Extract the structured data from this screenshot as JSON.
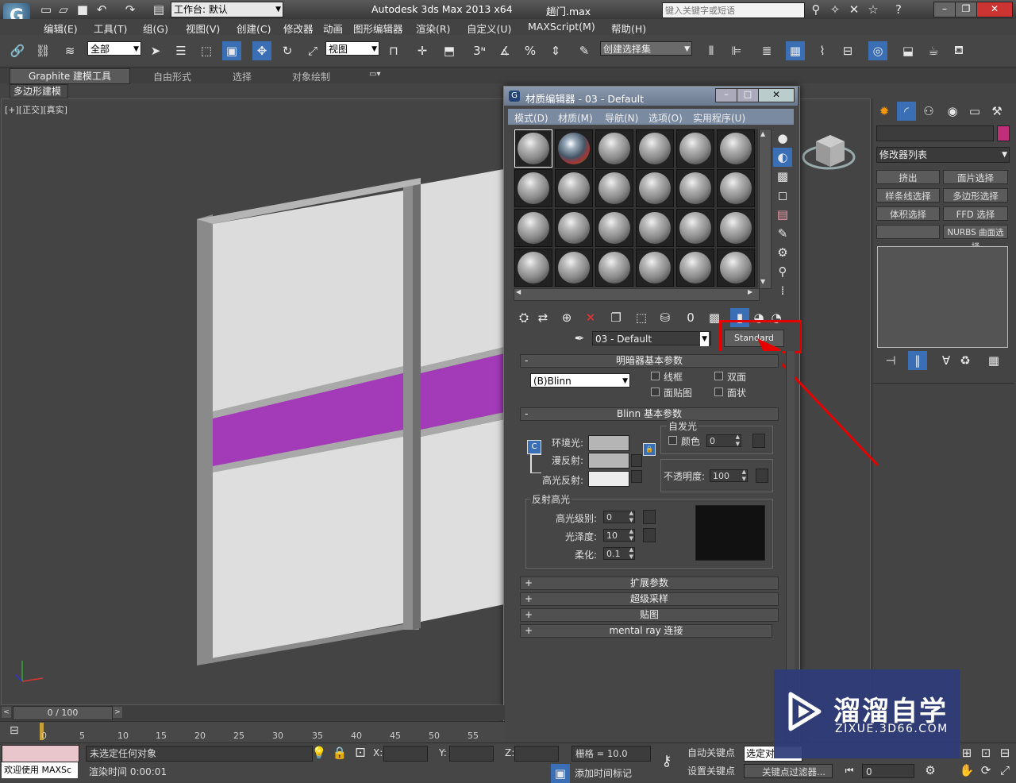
{
  "title_bar": {
    "workspace_label": "工作台: 默认",
    "app_title": "Autodesk 3ds Max  2013 x64",
    "file_name": "趟门.max",
    "search_placeholder": "键入关键字或短语"
  },
  "menu": [
    "编辑(E)",
    "工具(T)",
    "组(G)",
    "视图(V)",
    "创建(C)",
    "修改器",
    "动画",
    "图形编辑器",
    "渲染(R)",
    "自定义(U)",
    "MAXScript(M)",
    "帮助(H)"
  ],
  "toolbar": {
    "selection_filter": "全部",
    "ref_coord": "视图",
    "named_selection": "创建选择集"
  },
  "ribbon": {
    "tabs": [
      "Graphite 建模工具",
      "自由形式",
      "选择",
      "对象绘制"
    ],
    "sub_label": "多边形建模"
  },
  "viewport": {
    "label": "[+][正交][真实]",
    "accent_color": "#a33ab8"
  },
  "material_editor": {
    "title": "材质编辑器 - 03 - Default",
    "menu": [
      "模式(D)",
      "材质(M)",
      "导航(N)",
      "选项(O)",
      "实用程序(U)"
    ],
    "material_name": "03 - Default",
    "material_type": "Standard",
    "rollouts": {
      "shader_basic": "明暗器基本参数",
      "shader_type": "(B)Blinn",
      "checkbox_wire": "线框",
      "checkbox_two_sided": "双面",
      "checkbox_face_map": "面贴图",
      "checkbox_faceted": "面状",
      "blinn_basic": "Blinn 基本参数",
      "self_illum": "自发光",
      "self_illum_color": "颜色",
      "self_illum_value": "0",
      "ambient": "环境光:",
      "diffuse": "漫反射:",
      "specular": "高光反射:",
      "opacity": "不透明度:",
      "opacity_value": "100",
      "spec_highlights": "反射高光",
      "spec_level": "高光级别:",
      "spec_level_value": "0",
      "glossiness": "光泽度:",
      "glossiness_value": "10",
      "soften": "柔化:",
      "soften_value": "0.1",
      "extended": "扩展参数",
      "supersampling": "超级采样",
      "maps": "贴图",
      "mental_ray": "mental ray 连接"
    }
  },
  "command_panel": {
    "modifier_list": "修改器列表",
    "buttons": [
      "挤出",
      "面片选择",
      "样条线选择",
      "多边形选择",
      "体积选择",
      "FFD 选择",
      "",
      "NURBS 曲面选择"
    ]
  },
  "timeline": {
    "frame": "0 / 100",
    "ticks": [
      "0",
      "5",
      "10",
      "15",
      "20",
      "25",
      "30",
      "35",
      "40",
      "45",
      "50",
      "55"
    ]
  },
  "status": {
    "welcome": "欢迎使用 MAXSc",
    "selection": "未选定任何对象",
    "render_time": "渲染时间 0:00:01",
    "x_label": "X:",
    "y_label": "Y:",
    "z_label": "Z:",
    "grid": "栅格 = 10.0",
    "add_time_tag": "添加时间标记",
    "auto_key": "自动关键点",
    "set_key": "设置关键点",
    "selected_obj": "选定对",
    "key_filters": "关键点过滤器...",
    "frame_value": "0"
  },
  "watermark": {
    "brand": "溜溜自学",
    "url": "ZIXUE.3D66.COM"
  }
}
